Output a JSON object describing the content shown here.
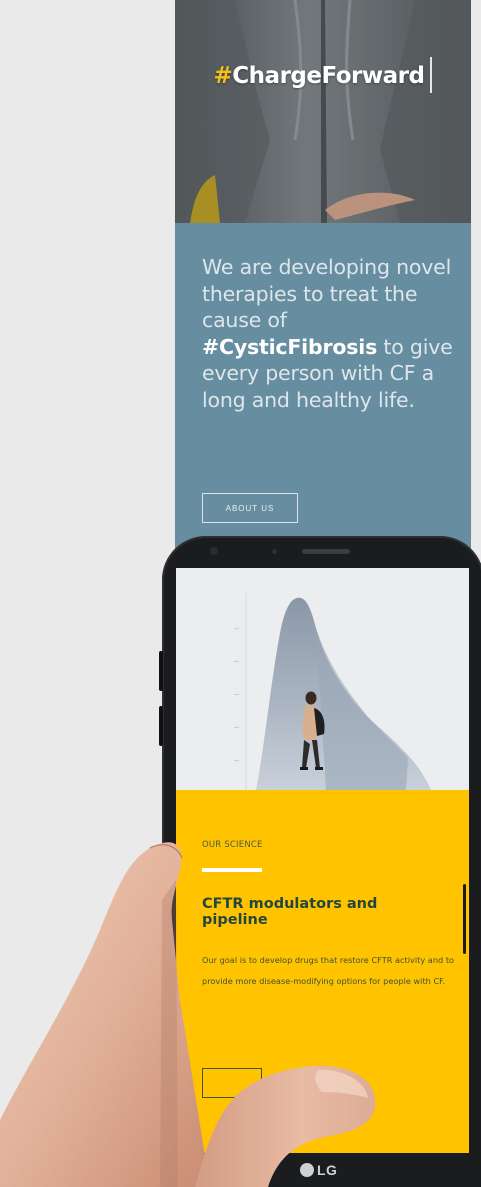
{
  "hero": {
    "hashtag_hash": "#",
    "hashtag_word": "ChargeForward"
  },
  "mission": {
    "text_before": "We are developing novel therapies to treat the cause of ",
    "highlight": "#CysticFibrosis",
    "text_after": " to give every person with CF a long and healthy life."
  },
  "about_button": {
    "label": "ABOUT US"
  },
  "phone": {
    "brand": "LG",
    "screen": {
      "eyebrow": "OUR SCIENCE",
      "headline": "CFTR modulators and pipeline",
      "body": "Our goal is to develop drugs that restore CFTR activity and to provide more disease-modifying options for people with CF."
    }
  },
  "colors": {
    "steel_blue": "#678ea0",
    "accent_yellow": "#ffc300",
    "hash_yellow": "#f5bf1b",
    "headline_green": "#24463e"
  }
}
